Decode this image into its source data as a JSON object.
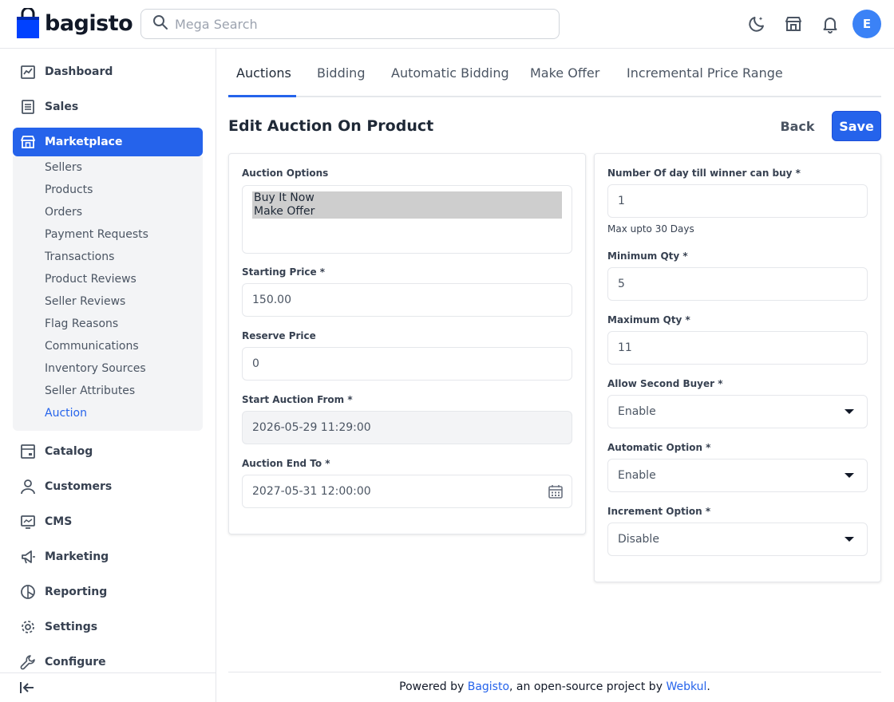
{
  "header": {
    "brand": "bagisto",
    "search_placeholder": "Mega Search",
    "avatar_initial": "E"
  },
  "sidebar": {
    "items": [
      {
        "label": "Dashboard",
        "icon": "dashboard-icon"
      },
      {
        "label": "Sales",
        "icon": "sales-icon"
      },
      {
        "label": "Marketplace",
        "icon": "marketplace-icon",
        "active": true
      },
      {
        "label": "Catalog",
        "icon": "catalog-icon"
      },
      {
        "label": "Customers",
        "icon": "customers-icon"
      },
      {
        "label": "CMS",
        "icon": "cms-icon"
      },
      {
        "label": "Marketing",
        "icon": "marketing-icon"
      },
      {
        "label": "Reporting",
        "icon": "reporting-icon"
      },
      {
        "label": "Settings",
        "icon": "settings-icon"
      },
      {
        "label": "Configure",
        "icon": "configure-icon"
      }
    ],
    "marketplace_submenu": [
      "Sellers",
      "Products",
      "Orders",
      "Payment Requests",
      "Transactions",
      "Product Reviews",
      "Seller Reviews",
      "Flag Reasons",
      "Communications",
      "Inventory Sources",
      "Seller Attributes",
      "Auction"
    ],
    "active_submenu": "Auction"
  },
  "tabs": [
    "Auctions",
    "Bidding",
    "Automatic Bidding",
    "Make Offer",
    "Incremental Price Range"
  ],
  "active_tab": "Auctions",
  "page": {
    "title": "Edit Auction On Product",
    "back_label": "Back",
    "save_label": "Save"
  },
  "form_left": {
    "auction_options_label": "Auction Options",
    "auction_options": [
      "Buy It Now",
      "Make Offer"
    ],
    "starting_price_label": "Starting Price *",
    "starting_price": "150.00",
    "reserve_price_label": "Reserve Price",
    "reserve_price": "0",
    "start_from_label": "Start Auction From *",
    "start_from": "2026-05-29 11:29:00",
    "end_to_label": "Auction End To *",
    "end_to": "2027-05-31 12:00:00"
  },
  "form_right": {
    "days_label": "Number Of day till winner can buy *",
    "days": "1",
    "days_hint": "Max upto 30 Days",
    "min_qty_label": "Minimum Qty *",
    "min_qty": "5",
    "max_qty_label": "Maximum Qty *",
    "max_qty": "11",
    "second_buyer_label": "Allow Second Buyer *",
    "second_buyer": "Enable",
    "automatic_label": "Automatic Option *",
    "automatic": "Enable",
    "increment_label": "Increment Option *",
    "increment": "Disable"
  },
  "footer": {
    "prefix": "Powered by ",
    "bagisto_link": "Bagisto",
    "middle": ", an open-source project by ",
    "webkul_link": "Webkul",
    "suffix": "."
  },
  "colors": {
    "primary": "#2563eb",
    "logo_blue": "#0041ff"
  }
}
